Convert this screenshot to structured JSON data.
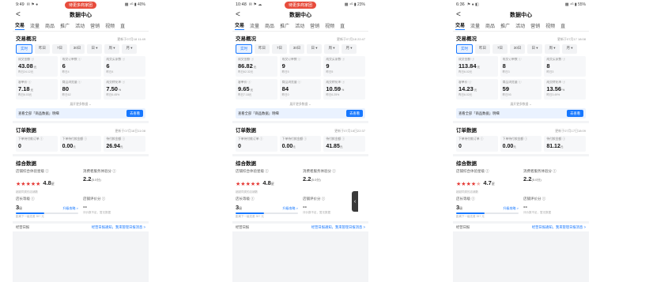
{
  "phones": [
    {
      "status": {
        "time": "9:49",
        "icons": "✉ ⚑ ●",
        "pill": "待更多商家团",
        "right": "▩ ⁴ᴳ ▮ 40%"
      },
      "header": {
        "back": "<",
        "title": "数据中心"
      },
      "tabs": [
        "交易",
        "流量",
        "商品",
        "推广",
        "活动",
        "营销",
        "视频",
        "直"
      ],
      "trade": {
        "title": "交易概况",
        "updated": "更新于07月18 11:49",
        "filters": [
          "实时",
          "昨日",
          "7日",
          "30日",
          "日 ▾",
          "周 ▾",
          "月 ▾"
        ],
        "metrics": [
          {
            "label": "成交金额 ⓘ",
            "value": "43.08",
            "unit": "元",
            "cmp": "昨日24.12元"
          },
          {
            "label": "成交订单数 ⓘ",
            "value": "6",
            "unit": "",
            "cmp": "昨日4"
          },
          {
            "label": "成交买家数 ⓘ",
            "value": "6",
            "unit": "",
            "cmp": "昨日4"
          },
          {
            "label": "客单价 ⓘ",
            "value": "7.18",
            "unit": "元",
            "cmp": "昨日6.03元"
          },
          {
            "label": "商品浏览量 ⓘ",
            "value": "80",
            "unit": "",
            "cmp": "昨日62"
          },
          {
            "label": "成交转化率 ⓘ",
            "value": "7.50",
            "unit": "%",
            "cmp": "昨日6.45%"
          }
        ],
        "expand": "展开更多数据 ⌄",
        "tip": "查看全部「商品数据」明细",
        "tip_btn": "去查看"
      },
      "orders": {
        "title": "订单数据",
        "updated": "更新于07月18日11:08",
        "cells": [
          {
            "label": "下单待付款订单 ⓘ",
            "value": "0",
            "unit": ""
          },
          {
            "label": "下单待付款金额 ⓘ",
            "value": "0.00",
            "unit": "元"
          },
          {
            "label": "待付款金额 ⓘ",
            "value": "26.94",
            "unit": "元"
          }
        ]
      },
      "overall": {
        "title": "综合数据",
        "score_label": "店铺综合体验星级 ⓘ",
        "stars": "4.8",
        "stars_full": 5,
        "star_unit": "星",
        "score_sub": "超越同类的店铺数",
        "service_label": "消费者服务体验分 ⓘ",
        "service": "2.2",
        "service_unit": "(5.0分)",
        "level_label": "店长等级 ⓘ",
        "level": "3",
        "level_unit": "级",
        "level_link": "升级攻略 >",
        "level_sub": "距离下一级还差 357 元",
        "level_fill": 0.45,
        "review_label": "店铺评价分 ⓘ",
        "review": "--",
        "review_sub": "评价数不足，暂无数据"
      },
      "bottom": {
        "left": "经营日报",
        "right": "经营日报通知，我来管理日报消息 >"
      }
    },
    {
      "status": {
        "time": "10:48",
        "icons": "✉ ⚑ ☁",
        "pill": "待更多商家团",
        "right": "▩ ⁴ᴳ ▮ 23%"
      },
      "header": {
        "back": "<",
        "title": "数据中心"
      },
      "tabs": [
        "交易",
        "流量",
        "商品",
        "推广",
        "活动",
        "营销",
        "视频",
        "直"
      ],
      "trade": {
        "title": "交易概况",
        "updated": "更新于07月18 22:47",
        "filters": [
          "实时",
          "昨日",
          "7日",
          "30日",
          "日 ▾",
          "周 ▾",
          "月 ▾"
        ],
        "metrics": [
          {
            "label": "成交金额 ⓘ",
            "value": "86.82",
            "unit": "元",
            "cmp": "昨日62.32元"
          },
          {
            "label": "成交订单数 ⓘ",
            "value": "9",
            "unit": "",
            "cmp": "昨日5"
          },
          {
            "label": "成交买家数 ⓘ",
            "value": "9",
            "unit": "",
            "cmp": "昨日5"
          },
          {
            "label": "客单价 ⓘ",
            "value": "9.65",
            "unit": "元",
            "cmp": "昨日7.18元"
          },
          {
            "label": "商品浏览量 ⓘ",
            "value": "84",
            "unit": "",
            "cmp": "昨日0"
          },
          {
            "label": "成交转化率 ⓘ",
            "value": "10.59",
            "unit": "%",
            "cmp": "昨日6.25%"
          }
        ],
        "expand": "展开更多数据 ⌄",
        "tip": "查看全部「商品数据」明细",
        "tip_btn": "去查看"
      },
      "orders": {
        "title": "订单数据",
        "updated": "更新于07月18日22:37",
        "cells": [
          {
            "label": "下单待付款订单 ⓘ",
            "value": "0",
            "unit": ""
          },
          {
            "label": "下单待付款金额 ⓘ",
            "value": "0.00",
            "unit": "元"
          },
          {
            "label": "待付款金额 ⓘ",
            "value": "41.85",
            "unit": "元"
          }
        ]
      },
      "overall": {
        "title": "综合数据",
        "score_label": "店铺综合体验星级 ⓘ",
        "stars": "4.8",
        "stars_full": 5,
        "star_unit": "星",
        "score_sub": "超越同类的店铺数",
        "service_label": "消费者服务体验分 ⓘ",
        "service": "2.2",
        "service_unit": "(5.0分)",
        "level_label": "店长等级 ⓘ",
        "level": "3",
        "level_unit": "级",
        "level_link": "升级攻略 >",
        "level_sub": "距离下一级还差 357 元",
        "level_fill": 0.45,
        "review_label": "店铺评价分 ⓘ",
        "review": "--",
        "review_sub": "评价数不足，暂无数据"
      },
      "bottom": {
        "left": "经营日报",
        "right": "经营日报通知，我来管理日报消息 >"
      }
    },
    {
      "status": {
        "time": "6:36",
        "icons": "⚑ ● ◧",
        "pill": "",
        "right": "▩ ⁴ᴳ ▮ 55%"
      },
      "header": {
        "back": "<",
        "title": "数据中心"
      },
      "tabs": [
        "交易",
        "流量",
        "商品",
        "推广",
        "活动",
        "营销",
        "视频",
        "直"
      ],
      "trade": {
        "title": "交易概况",
        "updated": "更新于07月17 18:08",
        "filters": [
          "实时",
          "昨日",
          "7日",
          "30日",
          "日 ▾",
          "周 ▾",
          "月 ▾"
        ],
        "metrics": [
          {
            "label": "成交金额 ⓘ",
            "value": "113.84",
            "unit": "元",
            "cmp": "昨日6.02元"
          },
          {
            "label": "成交订单数 ⓘ",
            "value": "8",
            "unit": "",
            "cmp": "昨日3"
          },
          {
            "label": "成交买家数 ⓘ",
            "value": "8",
            "unit": "",
            "cmp": "昨日3"
          },
          {
            "label": "客单价 ⓘ",
            "value": "14.23",
            "unit": "元",
            "cmp": "昨日6.02元"
          },
          {
            "label": "商品浏览量 ⓘ",
            "value": "59",
            "unit": "",
            "cmp": "昨日93"
          },
          {
            "label": "成交转化率 ⓘ",
            "value": "13.56",
            "unit": "%",
            "cmp": "昨日3.49%"
          }
        ],
        "expand": "展开更多数据 ⌄",
        "tip": "查看全部「商品数据」明细",
        "tip_btn": "去查看"
      },
      "orders": {
        "title": "订单数据",
        "updated": "更新于07月17日18:09",
        "cells": [
          {
            "label": "下单待付款订单 ⓘ",
            "value": "0",
            "unit": ""
          },
          {
            "label": "下单待付款金额 ⓘ",
            "value": "0.00",
            "unit": "元"
          },
          {
            "label": "待付款金额 ⓘ",
            "value": "81.12",
            "unit": "元"
          }
        ]
      },
      "overall": {
        "title": "综合数据",
        "score_label": "店铺综合体验星级 ⓘ",
        "stars": "4.7",
        "stars_full": 4,
        "star_unit": "星",
        "score_sub": "超越同类的店铺数",
        "service_label": "消费者服务体验分 ⓘ",
        "service": "2.2",
        "service_unit": "(5.0分)",
        "level_label": "店长等级 ⓘ",
        "level": "3",
        "level_unit": "级",
        "level_link": "升级攻略 >",
        "level_sub": "距离下一级还差 357 元",
        "level_fill": 0.45,
        "review_label": "店铺评价分 ⓘ",
        "review": "--",
        "review_sub": "评价数不足，暂无数据"
      },
      "bottom": {
        "left": "经营日报",
        "right": "经营日报通知，我来管理日报消息 >"
      }
    }
  ],
  "side_tab": {
    "glyph": "‹"
  },
  "colors": {
    "accent": "#1677ff",
    "star": "#e53935",
    "pill": "#e74c3c"
  }
}
